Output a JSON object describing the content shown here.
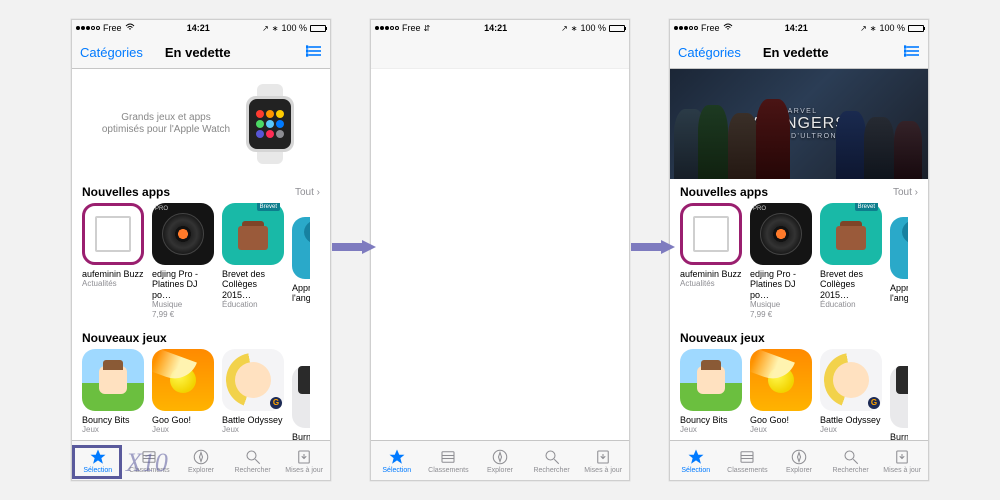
{
  "status": {
    "carrier": "Free",
    "time": "14:21",
    "battery_pct": "100 %",
    "location_icon": "↗",
    "bt_icon": "∗",
    "wifi_kind_p2": "⇵"
  },
  "nav": {
    "back": "Catégories",
    "title": "En vedette"
  },
  "banners": {
    "watch_line1": "Grands jeux et apps",
    "watch_line2": "optimisés pour l'Apple Watch",
    "avengers_line1": "AVENGERS",
    "avengers_line2": "L'ÈRE D'ULTRON",
    "avengers_marvel": "MARVEL"
  },
  "sections": {
    "apps_title": "Nouvelles apps",
    "games_title": "Nouveaux jeux",
    "all": "Tout ›"
  },
  "apps": [
    {
      "name": "aufeminin Buzz",
      "cat": "Actualités",
      "price": ""
    },
    {
      "name": "edjing Pro - Platines DJ po…",
      "cat": "Musique",
      "price": "7,99 €"
    },
    {
      "name": "Brevet des Collèges 2015…",
      "cat": "Éducation",
      "price": "",
      "badge": "Brevet"
    },
    {
      "name": "Appr… l'angl…",
      "cat": "",
      "price": ""
    }
  ],
  "edjing_pro_label": "PRO",
  "games": [
    {
      "name": "Bouncy Bits",
      "cat": "Jeux"
    },
    {
      "name": "Goo Goo!",
      "cat": "Jeux"
    },
    {
      "name": "Battle Odyssey",
      "cat": "Jeux"
    },
    {
      "name": "Burn …",
      "cat": "Jeux"
    }
  ],
  "tabs": {
    "selection": "Sélection",
    "classements": "Classements",
    "explorer": "Explorer",
    "rechercher": "Rechercher",
    "mises": "Mises à jour"
  },
  "overlay": {
    "x10": "X10"
  }
}
